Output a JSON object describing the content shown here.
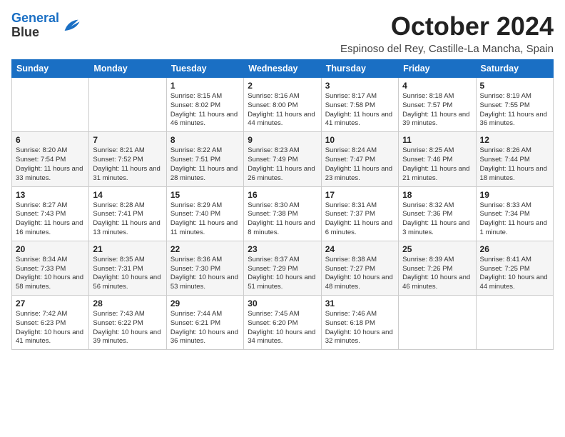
{
  "header": {
    "logo_line1": "General",
    "logo_line2": "Blue",
    "month_title": "October 2024",
    "location": "Espinoso del Rey, Castille-La Mancha, Spain"
  },
  "weekdays": [
    "Sunday",
    "Monday",
    "Tuesday",
    "Wednesday",
    "Thursday",
    "Friday",
    "Saturday"
  ],
  "weeks": [
    [
      {
        "day": "",
        "info": ""
      },
      {
        "day": "",
        "info": ""
      },
      {
        "day": "1",
        "info": "Sunrise: 8:15 AM\nSunset: 8:02 PM\nDaylight: 11 hours and 46 minutes."
      },
      {
        "day": "2",
        "info": "Sunrise: 8:16 AM\nSunset: 8:00 PM\nDaylight: 11 hours and 44 minutes."
      },
      {
        "day": "3",
        "info": "Sunrise: 8:17 AM\nSunset: 7:58 PM\nDaylight: 11 hours and 41 minutes."
      },
      {
        "day": "4",
        "info": "Sunrise: 8:18 AM\nSunset: 7:57 PM\nDaylight: 11 hours and 39 minutes."
      },
      {
        "day": "5",
        "info": "Sunrise: 8:19 AM\nSunset: 7:55 PM\nDaylight: 11 hours and 36 minutes."
      }
    ],
    [
      {
        "day": "6",
        "info": "Sunrise: 8:20 AM\nSunset: 7:54 PM\nDaylight: 11 hours and 33 minutes."
      },
      {
        "day": "7",
        "info": "Sunrise: 8:21 AM\nSunset: 7:52 PM\nDaylight: 11 hours and 31 minutes."
      },
      {
        "day": "8",
        "info": "Sunrise: 8:22 AM\nSunset: 7:51 PM\nDaylight: 11 hours and 28 minutes."
      },
      {
        "day": "9",
        "info": "Sunrise: 8:23 AM\nSunset: 7:49 PM\nDaylight: 11 hours and 26 minutes."
      },
      {
        "day": "10",
        "info": "Sunrise: 8:24 AM\nSunset: 7:47 PM\nDaylight: 11 hours and 23 minutes."
      },
      {
        "day": "11",
        "info": "Sunrise: 8:25 AM\nSunset: 7:46 PM\nDaylight: 11 hours and 21 minutes."
      },
      {
        "day": "12",
        "info": "Sunrise: 8:26 AM\nSunset: 7:44 PM\nDaylight: 11 hours and 18 minutes."
      }
    ],
    [
      {
        "day": "13",
        "info": "Sunrise: 8:27 AM\nSunset: 7:43 PM\nDaylight: 11 hours and 16 minutes."
      },
      {
        "day": "14",
        "info": "Sunrise: 8:28 AM\nSunset: 7:41 PM\nDaylight: 11 hours and 13 minutes."
      },
      {
        "day": "15",
        "info": "Sunrise: 8:29 AM\nSunset: 7:40 PM\nDaylight: 11 hours and 11 minutes."
      },
      {
        "day": "16",
        "info": "Sunrise: 8:30 AM\nSunset: 7:38 PM\nDaylight: 11 hours and 8 minutes."
      },
      {
        "day": "17",
        "info": "Sunrise: 8:31 AM\nSunset: 7:37 PM\nDaylight: 11 hours and 6 minutes."
      },
      {
        "day": "18",
        "info": "Sunrise: 8:32 AM\nSunset: 7:36 PM\nDaylight: 11 hours and 3 minutes."
      },
      {
        "day": "19",
        "info": "Sunrise: 8:33 AM\nSunset: 7:34 PM\nDaylight: 11 hours and 1 minute."
      }
    ],
    [
      {
        "day": "20",
        "info": "Sunrise: 8:34 AM\nSunset: 7:33 PM\nDaylight: 10 hours and 58 minutes."
      },
      {
        "day": "21",
        "info": "Sunrise: 8:35 AM\nSunset: 7:31 PM\nDaylight: 10 hours and 56 minutes."
      },
      {
        "day": "22",
        "info": "Sunrise: 8:36 AM\nSunset: 7:30 PM\nDaylight: 10 hours and 53 minutes."
      },
      {
        "day": "23",
        "info": "Sunrise: 8:37 AM\nSunset: 7:29 PM\nDaylight: 10 hours and 51 minutes."
      },
      {
        "day": "24",
        "info": "Sunrise: 8:38 AM\nSunset: 7:27 PM\nDaylight: 10 hours and 48 minutes."
      },
      {
        "day": "25",
        "info": "Sunrise: 8:39 AM\nSunset: 7:26 PM\nDaylight: 10 hours and 46 minutes."
      },
      {
        "day": "26",
        "info": "Sunrise: 8:41 AM\nSunset: 7:25 PM\nDaylight: 10 hours and 44 minutes."
      }
    ],
    [
      {
        "day": "27",
        "info": "Sunrise: 7:42 AM\nSunset: 6:23 PM\nDaylight: 10 hours and 41 minutes."
      },
      {
        "day": "28",
        "info": "Sunrise: 7:43 AM\nSunset: 6:22 PM\nDaylight: 10 hours and 39 minutes."
      },
      {
        "day": "29",
        "info": "Sunrise: 7:44 AM\nSunset: 6:21 PM\nDaylight: 10 hours and 36 minutes."
      },
      {
        "day": "30",
        "info": "Sunrise: 7:45 AM\nSunset: 6:20 PM\nDaylight: 10 hours and 34 minutes."
      },
      {
        "day": "31",
        "info": "Sunrise: 7:46 AM\nSunset: 6:18 PM\nDaylight: 10 hours and 32 minutes."
      },
      {
        "day": "",
        "info": ""
      },
      {
        "day": "",
        "info": ""
      }
    ]
  ]
}
